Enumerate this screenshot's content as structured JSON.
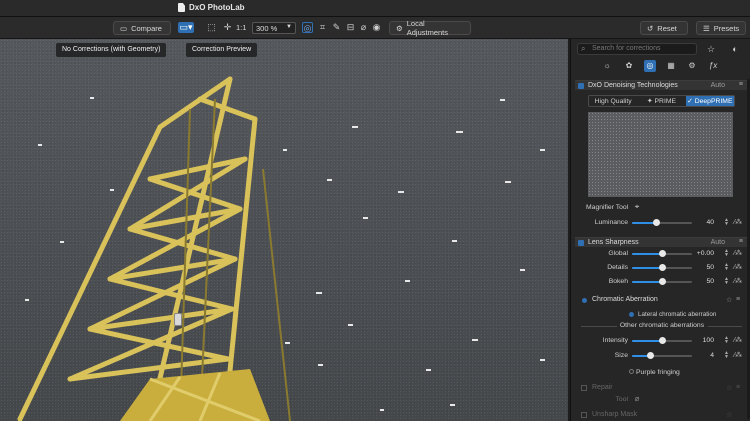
{
  "app": {
    "title": "DxO PhotoLab"
  },
  "toolbar": {
    "compare_label": "Compare",
    "one_to_one": "1:1",
    "zoom": "300 %",
    "local_adjustments_label": "Local Adjustments",
    "reset_label": "Reset",
    "presets_label": "Presets"
  },
  "viewport": {
    "tag_left": "No Corrections (with Geometry)",
    "tag_right": "Correction Preview"
  },
  "panel": {
    "search_placeholder": "Search for corrections",
    "denoising": {
      "title": "DxO Denoising Technologies",
      "auto": "Auto",
      "modes": [
        "High Quality",
        "PRIME",
        "DeepPRIME"
      ],
      "active_mode": "DeepPRIME",
      "magnifier_label": "Magnifier Tool",
      "luminance_label": "Luminance",
      "luminance_value": "40",
      "luminance_pct": 0.4
    },
    "lens_sharpness": {
      "title": "Lens Sharpness",
      "auto": "Auto",
      "rows": [
        {
          "label": "Global",
          "value": "+0.00",
          "pct": 0.5
        },
        {
          "label": "Details",
          "value": "50",
          "pct": 0.5
        },
        {
          "label": "Bokeh",
          "value": "50",
          "pct": 0.5
        }
      ]
    },
    "chromatic": {
      "title": "Chromatic Aberration",
      "lateral_label": "Lateral chromatic aberration",
      "other_label": "Other chromatic aberrations",
      "rows": [
        {
          "label": "Intensity",
          "value": "100",
          "pct": 0.5
        },
        {
          "label": "Size",
          "value": "4",
          "pct": 0.3
        }
      ],
      "purple_label": "Purple fringing"
    },
    "repair": {
      "title": "Repair",
      "tool_label": "Tool"
    },
    "unsharp": {
      "title": "Unsharp Mask"
    }
  },
  "colors": {
    "accent": "#2f6fb3",
    "slider_fill": "#2f8fe6",
    "crane": "#d9c25a"
  }
}
